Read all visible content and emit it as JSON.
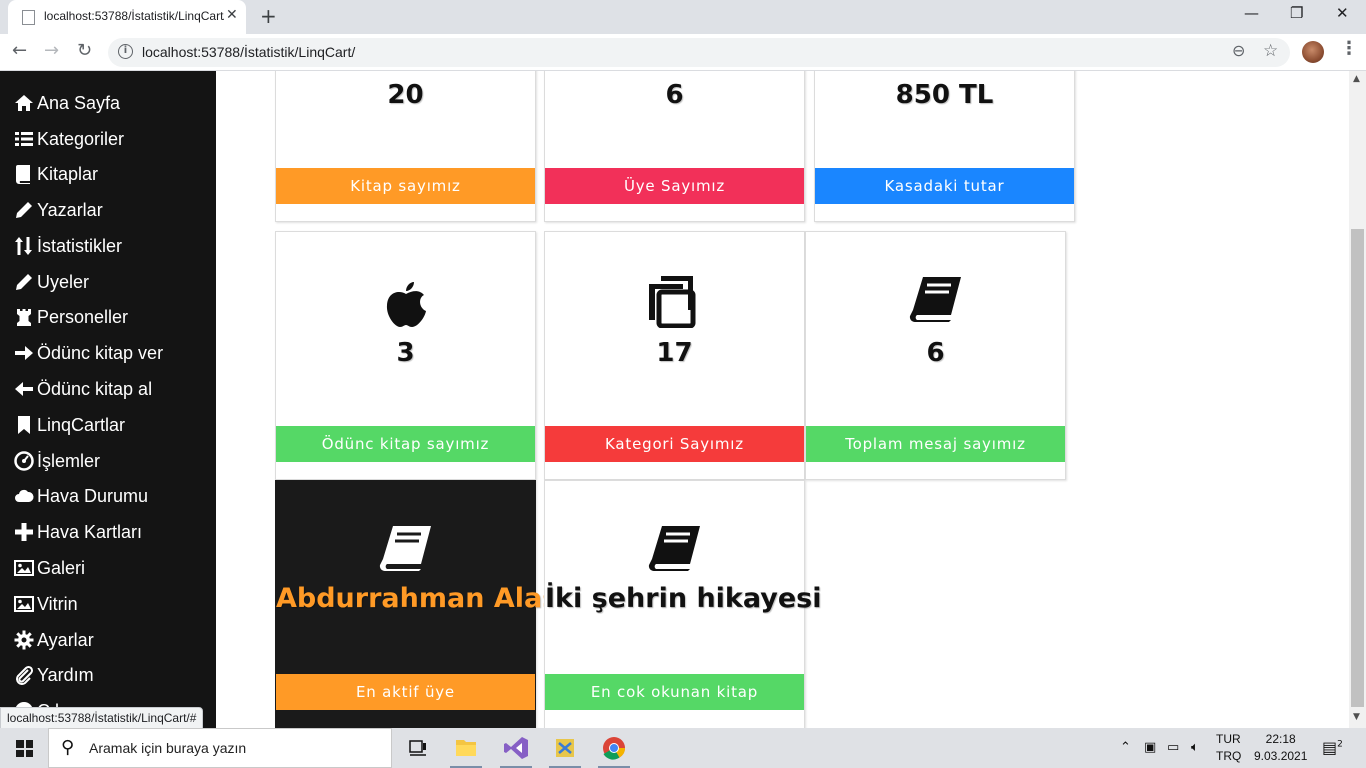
{
  "browser": {
    "tab_title": "localhost:53788/İstatistik/LinqCart/",
    "tab_close": "✕",
    "new_tab": "+",
    "url": "localhost:53788/İstatistik/LinqCart/",
    "status_url": "localhost:53788/İstatistik/LinqCart/#",
    "window_controls": [
      "—",
      "❐",
      "✕"
    ]
  },
  "sidebar": {
    "items": [
      {
        "label": "Ana Sayfa",
        "icon": "home-icon"
      },
      {
        "label": "Kategoriler",
        "icon": "list-icon"
      },
      {
        "label": "Kitaplar",
        "icon": "book-icon"
      },
      {
        "label": "Yazarlar",
        "icon": "pencil-icon"
      },
      {
        "label": "İstatistikler",
        "icon": "sort-icon"
      },
      {
        "label": "Uyeler",
        "icon": "pencil-icon"
      },
      {
        "label": "Personeller",
        "icon": "chess-rook-icon"
      },
      {
        "label": "Ödünc kitap ver",
        "icon": "arrow-right-icon"
      },
      {
        "label": "Ödünc kitap al",
        "icon": "arrow-left-icon"
      },
      {
        "label": "LinqCartlar",
        "icon": "bookmark-icon"
      },
      {
        "label": "İşlemler",
        "icon": "dashboard-icon"
      },
      {
        "label": "Hava Durumu",
        "icon": "cloud-icon"
      },
      {
        "label": "Hava Kartları",
        "icon": "plus-icon"
      },
      {
        "label": "Galeri",
        "icon": "picture-icon"
      },
      {
        "label": "Vitrin",
        "icon": "picture-icon"
      },
      {
        "label": "Ayarlar",
        "icon": "gear-icon"
      },
      {
        "label": "Yardım",
        "icon": "paperclip-icon"
      },
      {
        "label": "Çıkış",
        "icon": "power-icon"
      }
    ]
  },
  "cards": [
    {
      "value": "20",
      "label": "Kitap sayımız",
      "color": "#ff9a26",
      "icon": "building-icon"
    },
    {
      "value": "6",
      "label": "Üye Sayımız",
      "color": "#f23059",
      "icon": "inbox-icon"
    },
    {
      "value": "850 TL",
      "label": "Kasadaki tutar",
      "color": "#1a86ff",
      "icon": ""
    },
    {
      "value": "3",
      "label": "Ödünc kitap sayımız",
      "color": "#55d866",
      "icon": "apple-icon"
    },
    {
      "value": "17",
      "label": "Kategori Sayımız",
      "color": "#f53b3b",
      "icon": "copy-icon"
    },
    {
      "value": "6",
      "label": "Toplam mesaj sayımız",
      "color": "#55d866",
      "icon": "book-icon"
    },
    {
      "value": "Abdurrahman Alas",
      "label": "En aktif üye",
      "color": "#ff9a26",
      "value_color": "#ff9a26",
      "icon": "book-icon"
    },
    {
      "value": "İki şehrin hikayesi",
      "label": "En cok okunan kitap",
      "color": "#55d866",
      "icon": "book-icon"
    }
  ],
  "taskbar": {
    "search_placeholder": "Aramak için buraya yazın",
    "lang_top": "TUR",
    "lang_bottom": "TRQ",
    "time": "22:18",
    "date": "9.03.2021",
    "notifications": "2"
  }
}
